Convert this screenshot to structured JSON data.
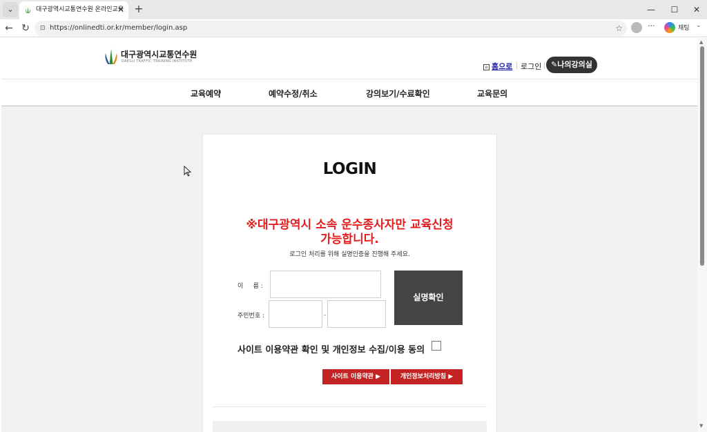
{
  "browser": {
    "tab_title": "대구광역시교통연수원 온라인교육",
    "url": "https://onlinedti.or.kr/member/login.asp",
    "copilot_label": "채팅"
  },
  "header": {
    "logo_title": "대구광역시교통연수원",
    "logo_subtitle": "DAEGU TRAFFIC TRAINING INSTITUTE",
    "home_label": "홈으로",
    "login_label": "로그인",
    "my_classroom_label": "나의강의실"
  },
  "nav": {
    "items": [
      "교육예약",
      "예약수정/취소",
      "강의보기/수료확인",
      "교육문의"
    ]
  },
  "login": {
    "title": "LOGIN",
    "notice_line1": "※대구광역시 소속 운수종사자만 교육신청",
    "notice_line2": "가능합니다.",
    "sub_notice": "로그인 처리를 위해 실명인증을 진행해 주세요.",
    "name_label": "이     름 :",
    "rrn_label": "주민번호 :",
    "dash": "-",
    "verify_button": "실명확인",
    "agree_text": "사이트 이용약관 확인 및 개인정보 수집/이용 동의",
    "terms_button": "사이트 이용약관 ▶",
    "privacy_button": "개인정보처리방침 ▶"
  },
  "colors": {
    "accent_red": "#e31d1d",
    "button_red": "#c42323",
    "verify_dark": "#444444",
    "home_link": "#1a1aa8"
  }
}
